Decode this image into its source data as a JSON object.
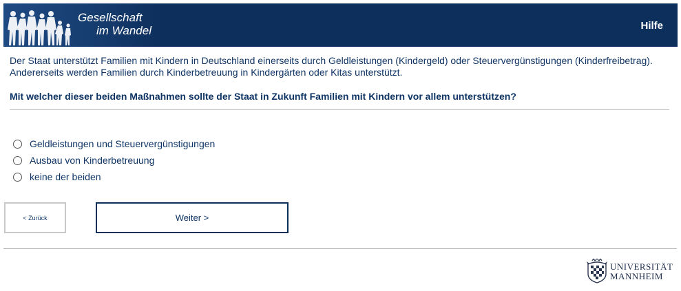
{
  "header": {
    "logo_line1": "Gesellschaft",
    "logo_line2": "im Wandel",
    "help_label": "Hilfe",
    "color_bg": "#0d2f5c"
  },
  "intro_text": "Der Staat unterstützt Familien mit Kindern in Deutschland einerseits durch Geldleistungen (Kindergeld) oder Steuervergünstigungen (Kinderfreibetrag). Andererseits werden Familien durch Kinderbetreuung in Kindergärten oder Kitas unterstützt.",
  "question": "Mit welcher dieser beiden Maßnahmen sollte der Staat in Zukunft Familien mit Kindern vor allem unterstützen?",
  "options": [
    "Geldleistungen und Steuervergünstigungen",
    "Ausbau von Kinderbetreuung",
    "keine der beiden"
  ],
  "nav": {
    "back_label": "< Zurück",
    "next_label": "Weiter >"
  },
  "footer": {
    "uni_line1": "UNIVERSITÄT",
    "uni_line2": "MANNHEIM",
    "crest_icon": "crest-icon"
  }
}
